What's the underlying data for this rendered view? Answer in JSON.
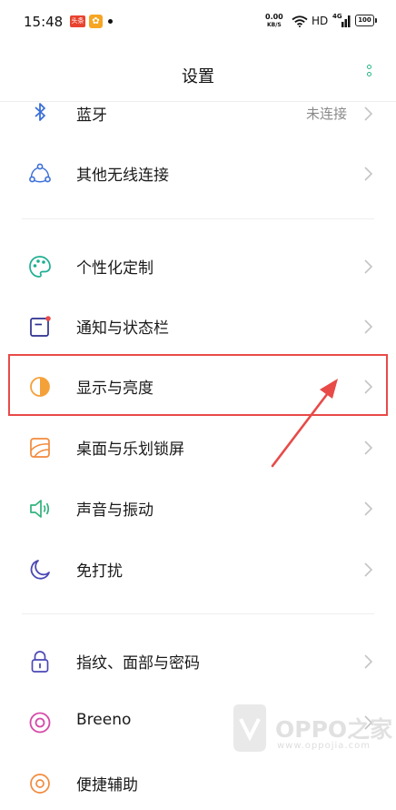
{
  "status_bar": {
    "time": "15:48",
    "notif_a": "头条",
    "notif_b": "✿",
    "net_speed_value": "0.00",
    "net_speed_unit": "KB/S",
    "hd_label": "HD",
    "signal_label": "4G",
    "battery": "100"
  },
  "header": {
    "title": "设置"
  },
  "rows": [
    {
      "label": "蓝牙",
      "value": "未连接",
      "icon": "bluetooth-icon"
    },
    {
      "label": "其他无线连接",
      "icon": "connections-icon"
    },
    {
      "label": "个性化定制",
      "icon": "palette-icon"
    },
    {
      "label": "通知与状态栏",
      "icon": "notification-icon"
    },
    {
      "label": "显示与亮度",
      "icon": "brightness-icon"
    },
    {
      "label": "桌面与乐划锁屏",
      "icon": "wallpaper-icon"
    },
    {
      "label": "声音与振动",
      "icon": "speaker-icon"
    },
    {
      "label": "免打扰",
      "icon": "moon-icon"
    },
    {
      "label": "指纹、面部与密码",
      "icon": "lock-icon"
    },
    {
      "label": "Breeno",
      "icon": "breeno-icon"
    },
    {
      "label": "便捷辅助",
      "icon": "assist-icon"
    }
  ],
  "annotation": {
    "highlight_color": "#e84a48"
  },
  "watermark": {
    "text": "OPPO之家",
    "url": "www.oppojia.com"
  },
  "colors": {
    "accent_green": "#26b589",
    "icon_blue": "#3a6fd8",
    "chevron": "#c4c4c4"
  }
}
